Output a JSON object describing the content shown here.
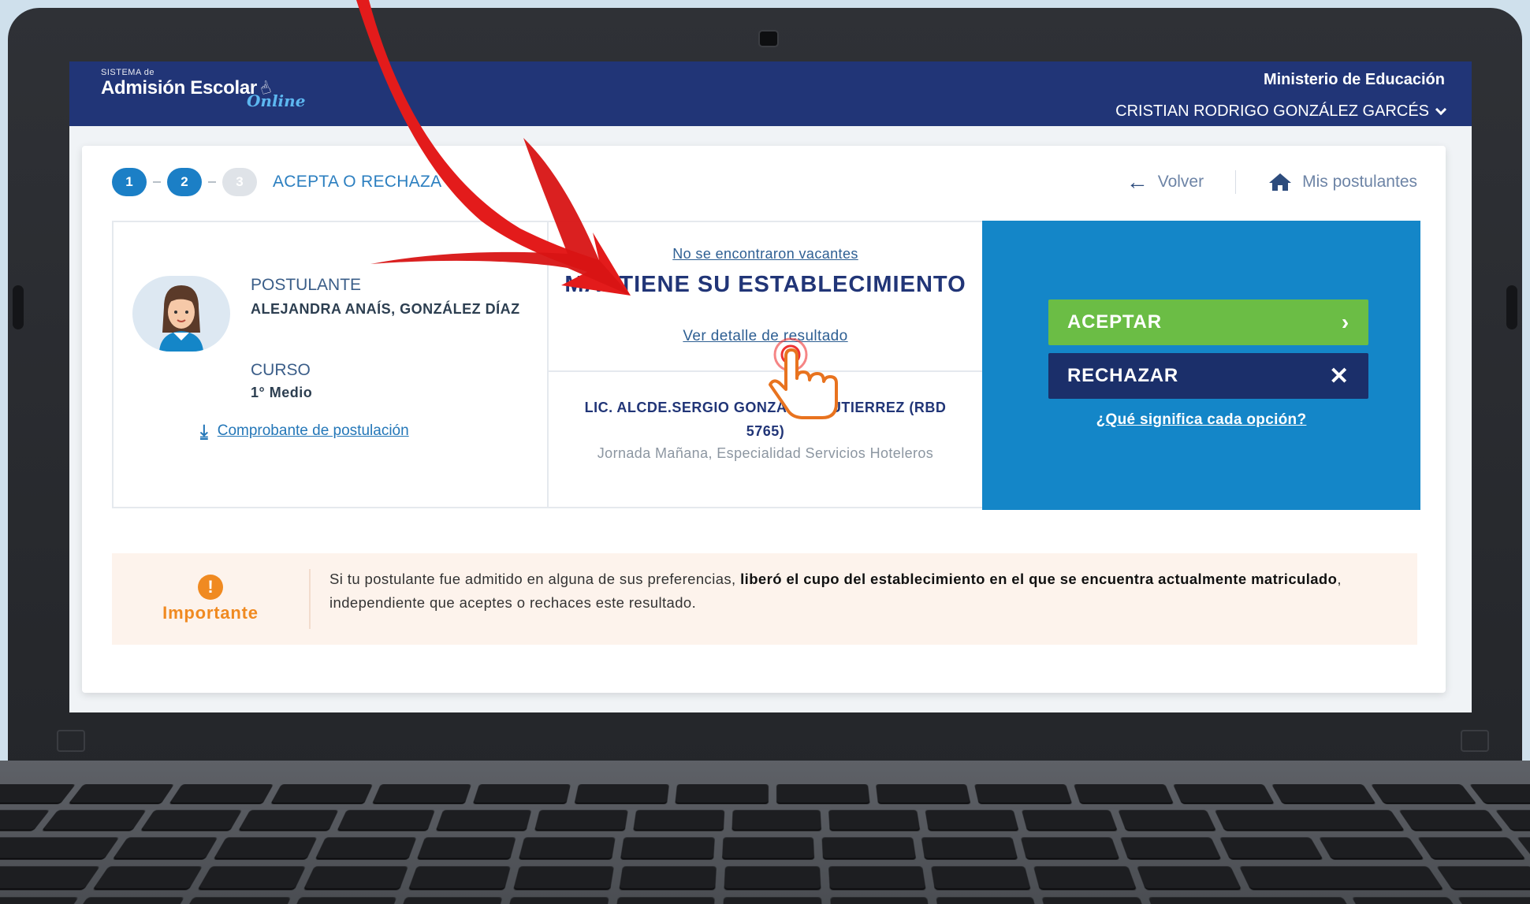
{
  "header": {
    "logo_small": "SISTEMA de",
    "logo_main": "Admisión Escolar",
    "logo_online": "Online",
    "ministry": "Ministerio de Educación",
    "user_name": "CRISTIAN RODRIGO GONZÁLEZ GARCÉS"
  },
  "stepper": {
    "steps": [
      "1",
      "2",
      "3"
    ],
    "current_step": 3,
    "title": "ACEPTA O RECHAZA"
  },
  "nav": {
    "back_label": "Volver",
    "applicants_label": "Mis postulantes"
  },
  "applicant": {
    "label": "POSTULANTE",
    "name": "ALEJANDRA ANAÍS, GONZÁLEZ DÍAZ",
    "course_label": "CURSO",
    "course": "1° Medio",
    "receipt_link": "Comprobante de postulación"
  },
  "result": {
    "no_vacancy": "No se encontraron vacantes",
    "status": "MANTIENE SU ESTABLECIMIENTO",
    "detail_link": "Ver detalle de resultado",
    "school_name": "LIC. ALCDE.SERGIO GONZÁLEZ GUTIERREZ (RBD 5765)",
    "school_detail": "Jornada Mañana, Especialidad Servicios Hoteleros"
  },
  "actions": {
    "accept_label": "ACEPTAR",
    "reject_label": "RECHAZAR",
    "help_link": "¿Qué significa cada opción?"
  },
  "notice": {
    "title": "Importante",
    "text_before": "Si tu postulante fue admitido en alguna de sus preferencias, ",
    "text_bold": "liberó el cupo del establecimiento en el que se encuentra actualmente matriculado",
    "text_after": ", independiente que aceptes o rechaces este resultado."
  },
  "colors": {
    "header_bg": "#213577",
    "accent_blue": "#1486c8",
    "accept_green": "#6bbd45",
    "reject_navy": "#1b2f6a",
    "notice_orange": "#f08a21",
    "arrow_red": "#e31b1b"
  }
}
